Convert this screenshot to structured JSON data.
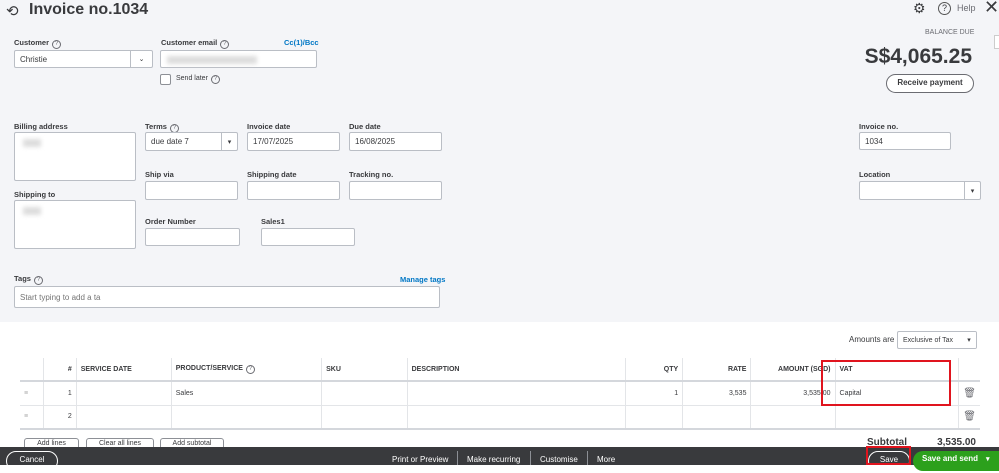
{
  "header": {
    "title": "Invoice no.1034",
    "help": "Help"
  },
  "customer": {
    "label": "Customer",
    "value": "Christie"
  },
  "email": {
    "label": "Customer email",
    "cc": "Cc(1)/Bcc",
    "send_later": "Send later"
  },
  "balance": {
    "label": "BALANCE DUE",
    "amount": "S$4,065.25",
    "receive": "Receive payment"
  },
  "billing": {
    "label": "Billing address"
  },
  "shipping_to": {
    "label": "Shipping to"
  },
  "terms": {
    "label": "Terms",
    "value": "due date 7"
  },
  "invoice_date": {
    "label": "Invoice date",
    "value": "17/07/2025"
  },
  "due_date": {
    "label": "Due date",
    "value": "16/08/2025"
  },
  "invoice_no": {
    "label": "Invoice no.",
    "value": "1034"
  },
  "location": {
    "label": "Location"
  },
  "ship_via": {
    "label": "Ship via"
  },
  "shipping_date": {
    "label": "Shipping date"
  },
  "tracking": {
    "label": "Tracking no."
  },
  "order_number": {
    "label": "Order Number"
  },
  "sales1": {
    "label": "Sales1"
  },
  "tags": {
    "label": "Tags",
    "manage": "Manage tags",
    "placeholder": "Start typing to add a ta"
  },
  "amounts": {
    "label": "Amounts are",
    "value": "Exclusive of Tax"
  },
  "table": {
    "headers": [
      "#",
      "SERVICE DATE",
      "PRODUCT/SERVICE",
      "SKU",
      "DESCRIPTION",
      "QTY",
      "RATE",
      "AMOUNT (SGD)",
      "VAT"
    ],
    "rows": [
      {
        "num": "1",
        "service_date": "",
        "product": "Sales",
        "sku": "",
        "description": "",
        "qty": "1",
        "rate": "3,535",
        "amount": "3,535.00",
        "vat": "Capital"
      },
      {
        "num": "2",
        "service_date": "",
        "product": "",
        "sku": "",
        "description": "",
        "qty": "",
        "rate": "",
        "amount": "",
        "vat": ""
      }
    ]
  },
  "actions": {
    "add_lines": "Add lines",
    "clear": "Clear all lines",
    "add_subtotal": "Add subtotal"
  },
  "subtotal": {
    "label": "Subtotal",
    "value": "3,535.00"
  },
  "footer": {
    "cancel": "Cancel",
    "print": "Print or Preview",
    "recurring": "Make recurring",
    "customise": "Customise",
    "more": "More",
    "save": "Save",
    "save_send": "Save and send"
  }
}
